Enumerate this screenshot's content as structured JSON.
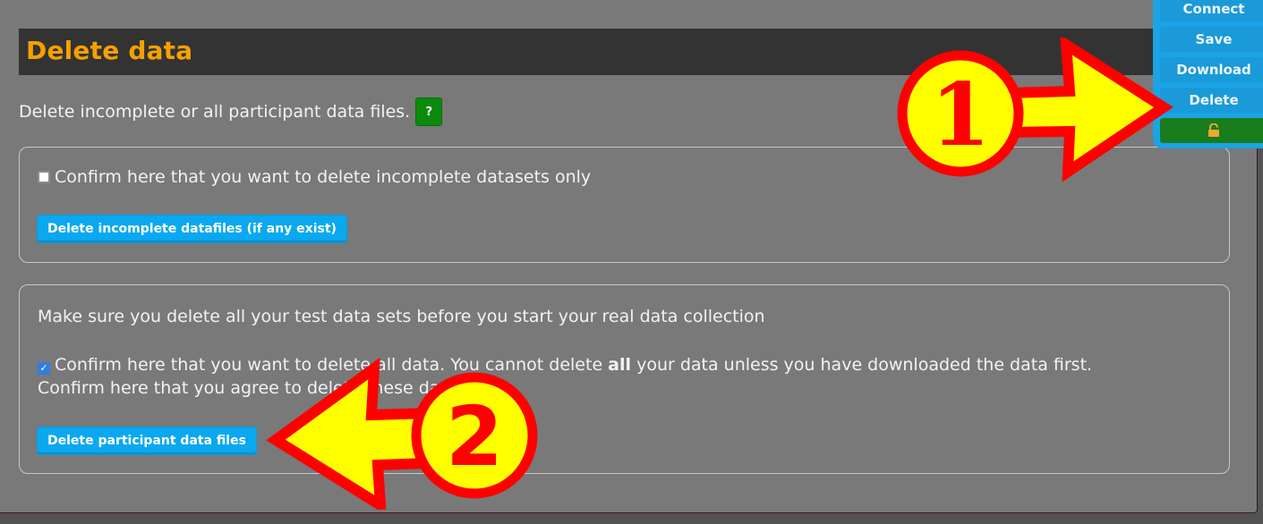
{
  "page": {
    "title": "Delete data",
    "intro": "Delete incomplete or all participant data files.",
    "help_label": "?"
  },
  "incomplete_panel": {
    "checkbox_label": "Confirm here that you want to delete incomplete datasets only",
    "checkbox_checked": false,
    "button_label": "Delete incomplete datafiles (if any exist)"
  },
  "all_panel": {
    "note": "Make sure you delete all your test data sets before you start your real data collection",
    "checkbox_label_pre": "Confirm here that you want to delete all data. You cannot delete ",
    "checkbox_label_bold": "all",
    "checkbox_label_post": " your data unless you have downloaded the data first.",
    "checkbox_checked": true,
    "agree_text": "Confirm here that you agree to delete these data",
    "button_label": "Delete participant data files"
  },
  "side_menu": {
    "items": [
      {
        "label": "Connect"
      },
      {
        "label": "Save"
      },
      {
        "label": "Download"
      },
      {
        "label": "Delete"
      }
    ],
    "lock_icon": "unlocked-padlock-icon"
  },
  "annotations": [
    {
      "number": "1",
      "points_to": "Delete"
    },
    {
      "number": "2",
      "points_to": "Delete participant data files"
    }
  ],
  "colors": {
    "title": "#f5a000",
    "button": "#0aa8f0",
    "help": "#0b8a0b",
    "annotation_fill": "#ffff00",
    "annotation_stroke": "#ff0000"
  }
}
